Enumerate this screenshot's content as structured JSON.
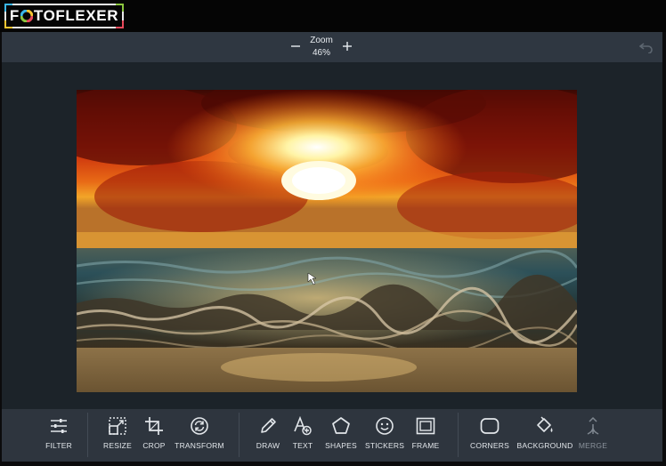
{
  "app": {
    "logo": {
      "prefix": "F",
      "suffix": "TOFLEXER"
    }
  },
  "zoom": {
    "title": "Zoom",
    "value": "46%",
    "minus_icon": "minus-icon",
    "plus_icon": "plus-icon",
    "undo_icon": "undo-icon"
  },
  "photo": {
    "subject": "sunset over ocean waves",
    "colors": {
      "sky": "#c2200c",
      "sun": "#fff6b0",
      "sea": "#2b4d55",
      "sand": "#a07c45"
    }
  },
  "toolbar": {
    "tools": [
      {
        "label": "FILTER",
        "icon": "sliders-icon"
      },
      {
        "label": "RESIZE",
        "icon": "resize-icon"
      },
      {
        "label": "CROP",
        "icon": "crop-icon"
      },
      {
        "label": "TRANSFORM",
        "icon": "transform-icon"
      },
      {
        "label": "DRAW",
        "icon": "pencil-icon"
      },
      {
        "label": "TEXT",
        "icon": "text-icon"
      },
      {
        "label": "SHAPES",
        "icon": "pentagon-icon"
      },
      {
        "label": "STICKERS",
        "icon": "smiley-icon"
      },
      {
        "label": "FRAME",
        "icon": "frame-icon"
      },
      {
        "label": "CORNERS",
        "icon": "rounded-rect-icon"
      },
      {
        "label": "BACKGROUND",
        "icon": "paint-bucket-icon"
      },
      {
        "label": "MERGE",
        "icon": "merge-icon",
        "disabled": true
      }
    ]
  },
  "theme": {
    "header_bg": "#050505",
    "zoombar_bg": "#2f3741",
    "canvas_bg": "#1c2329",
    "toolbar_bg": "#2e353e",
    "label_color": "#e2e6ea"
  }
}
